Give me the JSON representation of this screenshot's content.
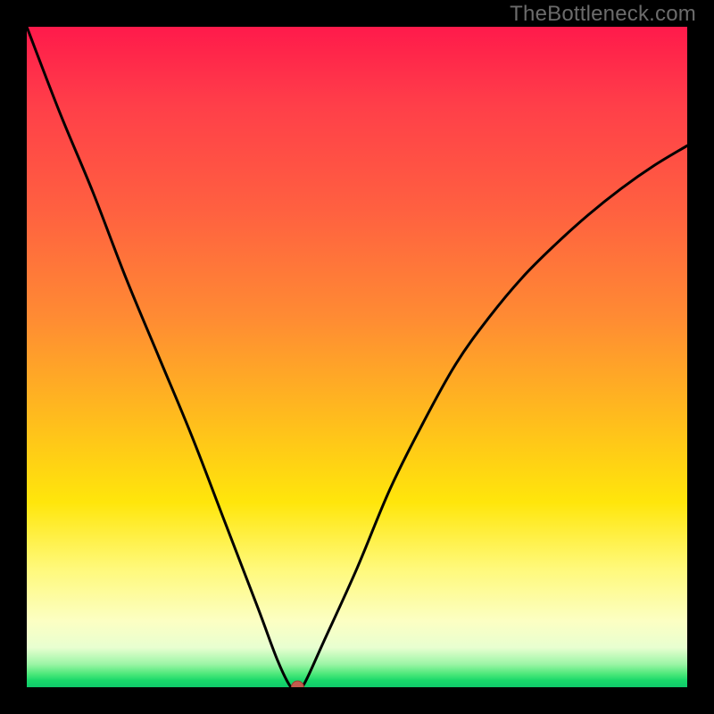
{
  "watermark": "TheBottleneck.com",
  "chart_data": {
    "type": "line",
    "title": "",
    "xlabel": "",
    "ylabel": "",
    "x_range": [
      0,
      100
    ],
    "y_range": [
      0,
      100
    ],
    "grid": false,
    "legend": false,
    "series": [
      {
        "name": "curve",
        "x": [
          0,
          5,
          10,
          15,
          20,
          25,
          30,
          35,
          38,
          40,
          41,
          42,
          45,
          50,
          55,
          60,
          65,
          70,
          75,
          80,
          85,
          90,
          95,
          100
        ],
        "y": [
          100,
          87,
          75,
          62,
          50,
          38,
          25,
          12,
          4,
          0,
          0,
          0.5,
          7,
          18,
          30,
          40,
          49,
          56,
          62,
          67,
          71.5,
          75.5,
          79,
          82
        ]
      }
    ],
    "vertex_marker": {
      "x": 41,
      "y": 0
    },
    "colors": {
      "curve": "#000000",
      "marker_fill": "#c25a4d",
      "background_top": "#ff1a4b",
      "background_bottom": "#0fc96a"
    }
  }
}
